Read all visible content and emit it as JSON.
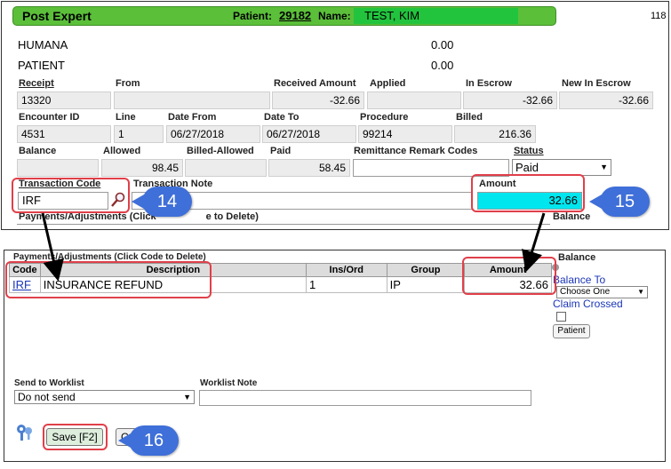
{
  "header": {
    "title": "Post Expert",
    "patient_label": "Patient:",
    "patient_id": "29182",
    "name_label": "Name:",
    "patient_name": "TEST, KIM",
    "corner_number": "118"
  },
  "payers": [
    {
      "name": "HUMANA",
      "amount": "0.00"
    },
    {
      "name": "PATIENT",
      "amount": "0.00"
    }
  ],
  "receipt_row": {
    "receipt_label": "Receipt",
    "receipt": "13320",
    "from_label": "From",
    "from": "",
    "received_label": "Received Amount",
    "received": "-32.66",
    "applied_label": "Applied",
    "applied": "",
    "in_escrow_label": "In Escrow",
    "in_escrow": "-32.66",
    "new_in_escrow_label": "New In Escrow",
    "new_in_escrow": "-32.66"
  },
  "encounter_row": {
    "encounter_label": "Encounter ID",
    "encounter": "4531",
    "line_label": "Line",
    "line": "1",
    "date_from_label": "Date From",
    "date_from": "06/27/2018",
    "date_to_label": "Date To",
    "date_to": "06/27/2018",
    "procedure_label": "Procedure",
    "procedure": "99214",
    "billed_label": "Billed",
    "billed": "216.36"
  },
  "balance_row": {
    "balance_label": "Balance",
    "balance": "",
    "allowed_label": "Allowed",
    "allowed": "98.45",
    "billed_allowed_label": "Billed-Allowed",
    "billed_allowed": "",
    "paid_label": "Paid",
    "paid": "58.45",
    "remark_label": "Remittance Remark Codes",
    "remark": "",
    "status_label": "Status",
    "status": "Paid"
  },
  "transaction": {
    "code_label": "Transaction Code",
    "code": "IRF",
    "note_label": "Transaction Note",
    "note": "",
    "amount_label": "Amount",
    "amount": "32.66"
  },
  "top_partial": {
    "payments_label": "Payments/Adjustments (Click",
    "payments_tail": "e to Delete)",
    "balance_label": "Balance"
  },
  "payments": {
    "title": "Payments/Adjustments (Click Code to Delete)",
    "columns": [
      "Code",
      "Description",
      "Ins/Ord",
      "Group",
      "Amount"
    ],
    "rows": [
      {
        "code": "IRF",
        "description": "INSURANCE REFUND",
        "ins_ord": "1",
        "group": "IP",
        "amount": "32.66"
      }
    ]
  },
  "right_panel": {
    "balance_label": "Balance",
    "balance_to_label": "Balance To",
    "balance_to_value": "Choose One",
    "claim_crossed_label": "Claim Crossed",
    "patient_button": "Patient"
  },
  "worklist": {
    "send_label": "Send to Worklist",
    "send_value": "Do not send",
    "note_label": "Worklist Note",
    "note": ""
  },
  "footer": {
    "save_button": "Save [F2]",
    "other_button": "C"
  },
  "callouts": [
    "14",
    "15",
    "16"
  ],
  "colors": {
    "header_green": "#5bbf3a",
    "name_green": "#22c43e",
    "amount_highlight": "#00e6ee",
    "callout_blue": "#3f6fd8",
    "annotation_red": "#e0404a"
  }
}
